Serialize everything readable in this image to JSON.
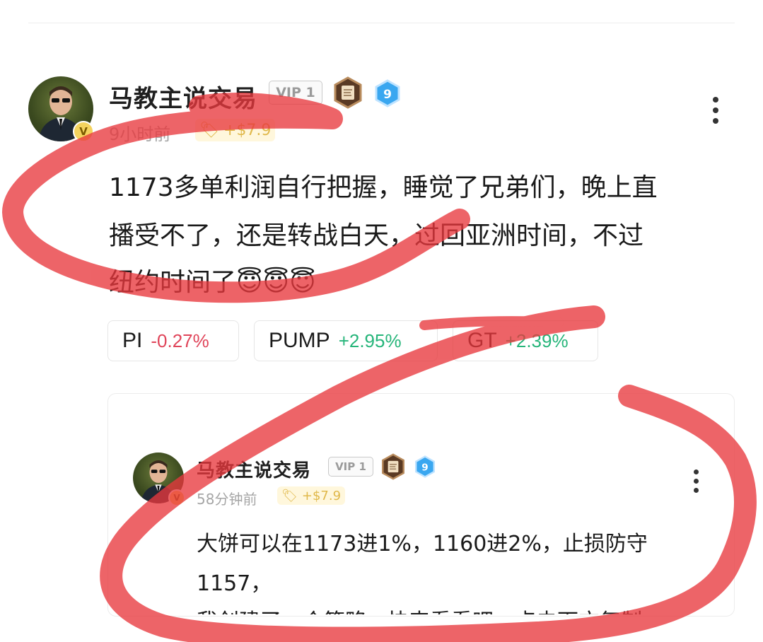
{
  "post": {
    "author": "马教主说交易",
    "vip": "VIP 1",
    "level": "9",
    "time": "9小时前",
    "reward": "+$7.9",
    "content_line1": "1173多单利润自行把握，睡觉了兄弟们，晚上直",
    "content_line2": "播受不了，还是转战白天，过回亚洲时间，不过",
    "content_line3": "纽约时间了",
    "emojis": "😇😇😇",
    "avatar_badge": "V",
    "icons": {
      "avatar": "avatar-photo",
      "medal": "scroll-medal-icon",
      "level": "level-hexagon-icon",
      "reward": "coin-icon",
      "more": "more-vertical-icon"
    }
  },
  "tickers": [
    {
      "symbol": "PI",
      "change": "-0.27%",
      "direction": "down"
    },
    {
      "symbol": "PUMP",
      "change": "+2.95%",
      "direction": "up"
    },
    {
      "symbol": "GT",
      "change": "+2.39%",
      "direction": "up"
    }
  ],
  "quoted": {
    "author": "马教主说交易",
    "vip": "VIP 1",
    "level": "9",
    "time": "58分钟前",
    "reward": "+$7.9",
    "avatar_badge": "V",
    "content_line1": "大饼可以在1173进1%，1160进2%，止损防守",
    "content_line2": "1157，",
    "content_line3": "我创建了一个策略，快来看看吧，点击下方复制"
  },
  "colors": {
    "down": "#e0455a",
    "up": "#26b57a",
    "scribble": "#e8383d",
    "reward": "#e0b84a"
  }
}
